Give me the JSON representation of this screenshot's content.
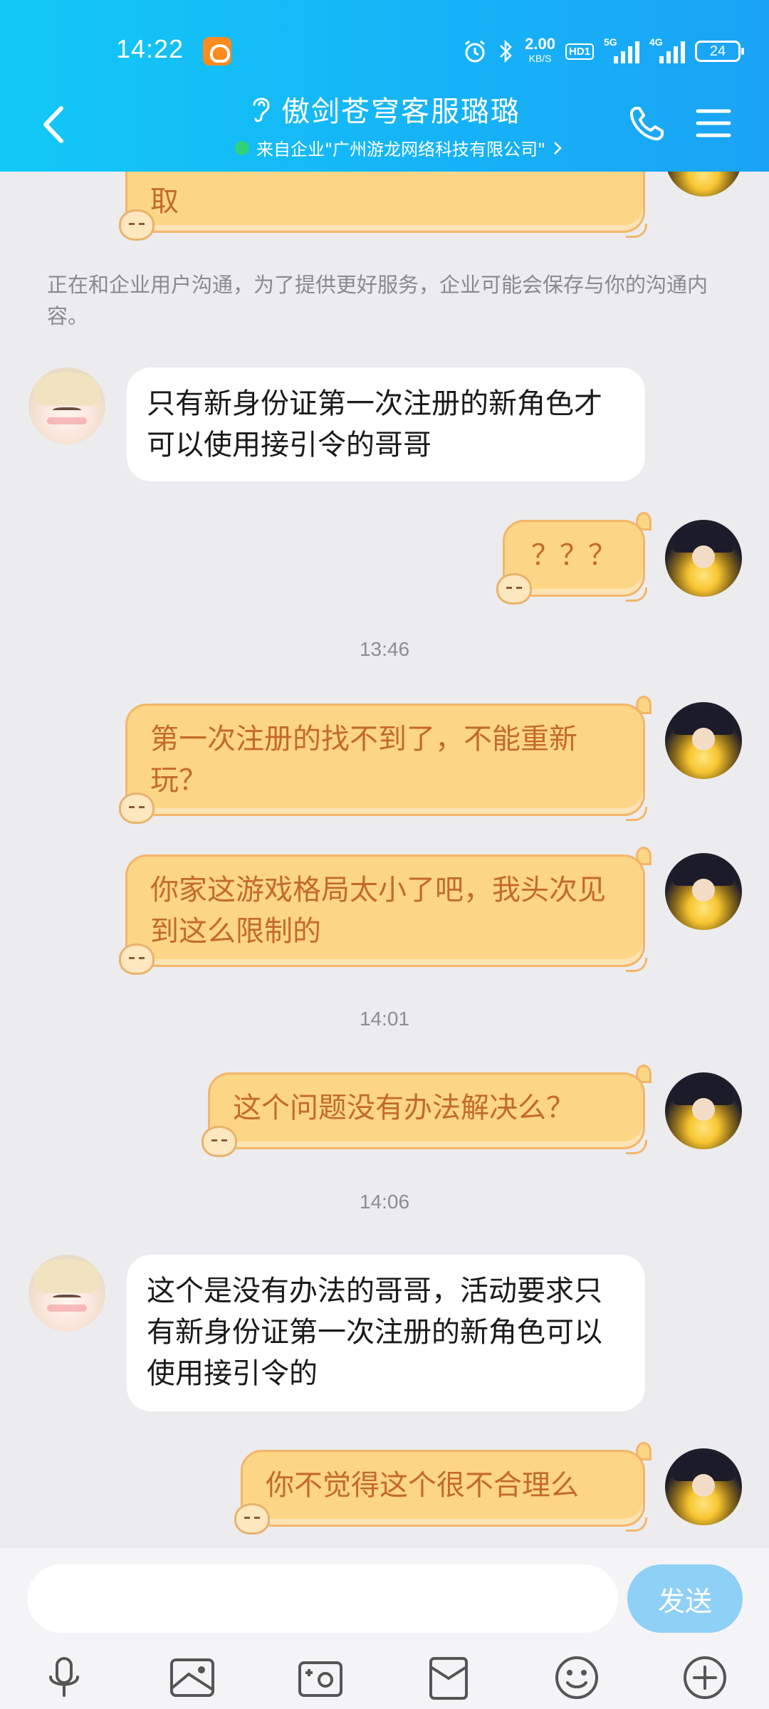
{
  "status_bar": {
    "time": "14:22",
    "net_speed": "2.00",
    "net_speed_unit": "KB/S",
    "hd_label": "HD1",
    "sim1_label": "5G",
    "sim2_label": "4G",
    "battery": "24"
  },
  "header": {
    "title": "傲剑苍穹客服璐璐",
    "subtitle": "来自企业\"广州游龙网络科技有限公司\"",
    "accent": "#16b4f7"
  },
  "chat": {
    "top_partial_text": "取",
    "notice": "正在和企业用户沟通，为了提供更好服务，企业可能会保存与你的沟通内容。",
    "messages": [
      {
        "side": "left",
        "text": "只有新身份证第一次注册的新角色才可以使用接引令的哥哥"
      },
      {
        "side": "right",
        "text": "？？？"
      },
      {
        "side": "right",
        "text": "第一次注册的找不到了，不能重新玩？"
      },
      {
        "side": "right",
        "text": "你家这游戏格局太小了吧，我头次见到这么限制的"
      },
      {
        "side": "right",
        "text": "这个问题没有办法解决么？"
      },
      {
        "side": "left",
        "text": "这个是没有办法的哥哥，活动要求只有新身份证第一次注册的新角色可以使用接引令的"
      },
      {
        "side": "right",
        "text": "你不觉得这个很不合理么"
      }
    ],
    "timestamps": [
      "13:46",
      "14:01",
      "14:06"
    ]
  },
  "input": {
    "value": "",
    "placeholder": "",
    "send_label": "发送"
  },
  "colors": {
    "cat_bubble_bg": "#fdd586",
    "cat_bubble_text": "#c36b28",
    "send_button": "#8fd0f6"
  }
}
